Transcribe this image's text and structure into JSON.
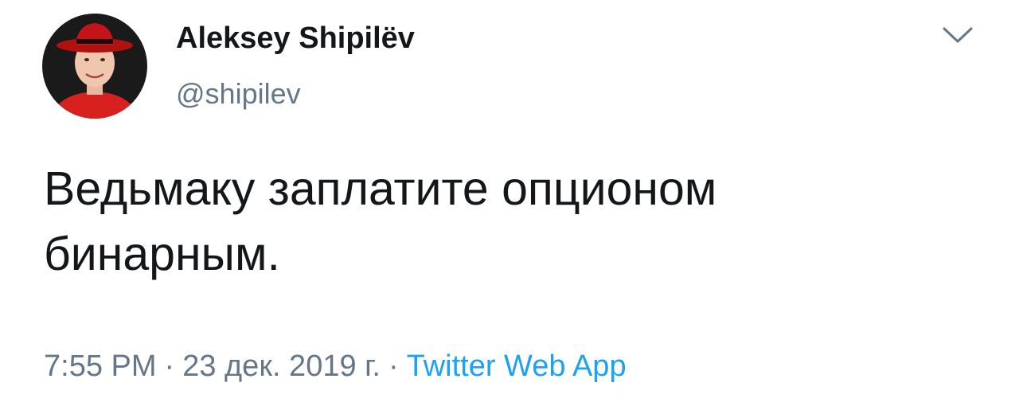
{
  "author": {
    "display_name": "Aleksey Shipilëv",
    "handle": "@shipilev",
    "avatar_icon": "profile-photo"
  },
  "menu": {
    "icon": "chevron-down-icon"
  },
  "tweet": {
    "text_line1": "Ведьмаку заплатите опционом",
    "text_line2": "бинарным."
  },
  "meta": {
    "time": "7:55 PM",
    "separator": "·",
    "date": "23 дек. 2019 г.",
    "source": "Twitter Web App"
  },
  "colors": {
    "text": "#14171a",
    "secondary": "#657786",
    "link": "#1da1f2"
  }
}
